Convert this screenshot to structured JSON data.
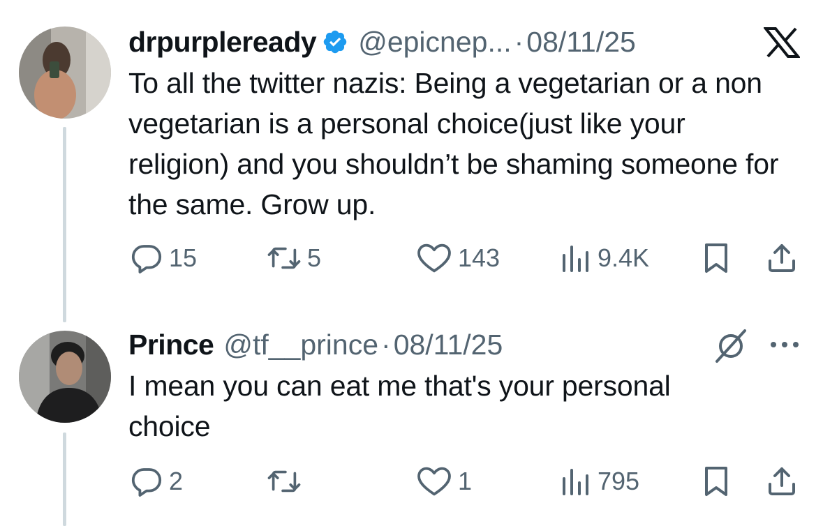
{
  "tweets": [
    {
      "display_name": "drpurpleready",
      "handle": "@epicnep...",
      "separator": "·",
      "date": "08/11/25",
      "text": "To all the twitter nazis: Being a vegetarian or a non vegetarian is a personal choice(just like your religion) and you shouldn’t be shaming someone for the same. Grow up.",
      "verified": true,
      "corner_icon": "x-logo-icon",
      "stats": {
        "replies": "15",
        "reposts": "5",
        "likes": "143",
        "views": "9.4K"
      }
    },
    {
      "display_name": "Prince",
      "handle": "@tf__prince",
      "separator": "·",
      "date": "08/11/25",
      "text": "I mean you can eat me that's your personal choice",
      "verified": false,
      "corner_icon": "grok-icon",
      "menu_icon": "more-icon",
      "stats": {
        "replies": "2",
        "reposts": "",
        "likes": "1",
        "views": "795"
      }
    }
  ],
  "colors": {
    "text": "#0f1419",
    "secondary": "#536471",
    "verified_blue": "#1d9bf0",
    "thread_line": "#cfd9de"
  }
}
